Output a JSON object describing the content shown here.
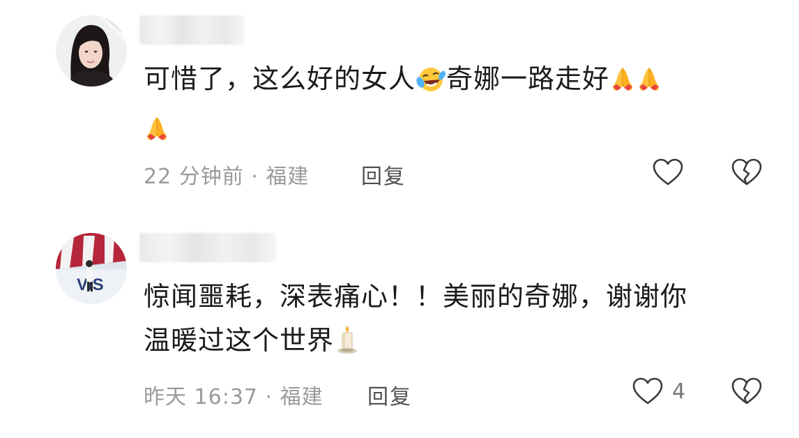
{
  "comments": [
    {
      "avatar_icon": "woman-portrait-avatar",
      "text_lines": [
        {
          "segments": [
            {
              "type": "text",
              "value": "可惜了，这么好的女人"
            },
            {
              "type": "emoji",
              "icon": "laugh-cry-emoji"
            },
            {
              "type": "text",
              "value": "奇娜一路走好"
            },
            {
              "type": "emoji",
              "icon": "folded-hands-emoji"
            },
            {
              "type": "emoji",
              "icon": "folded-hands-emoji"
            }
          ]
        },
        {
          "segments": [
            {
              "type": "emoji",
              "icon": "folded-hands-emoji"
            }
          ]
        }
      ],
      "meta": "22 分钟前 · 福建",
      "reply_label": "回复",
      "like_count": "",
      "like_icon": "heart-outline-icon",
      "dislike_icon": "broken-heart-icon"
    },
    {
      "avatar_icon": "photo-person-avatar",
      "text_lines": [
        {
          "segments": [
            {
              "type": "text",
              "value": "惊闻噩耗，深表痛心！！美丽的奇娜，谢谢你"
            }
          ]
        },
        {
          "segments": [
            {
              "type": "text",
              "value": "温暖过这个世界"
            },
            {
              "type": "emoji",
              "icon": "candle-emoji"
            }
          ]
        }
      ],
      "meta": "昨天 16:37 · 福建",
      "reply_label": "回复",
      "like_count": "4",
      "like_icon": "heart-outline-icon",
      "dislike_icon": "broken-heart-icon"
    }
  ],
  "colors": {
    "text": "#1a1a1a",
    "meta": "#9a9a9a",
    "reply": "#505050",
    "icon_stroke": "#3a3a3a"
  }
}
